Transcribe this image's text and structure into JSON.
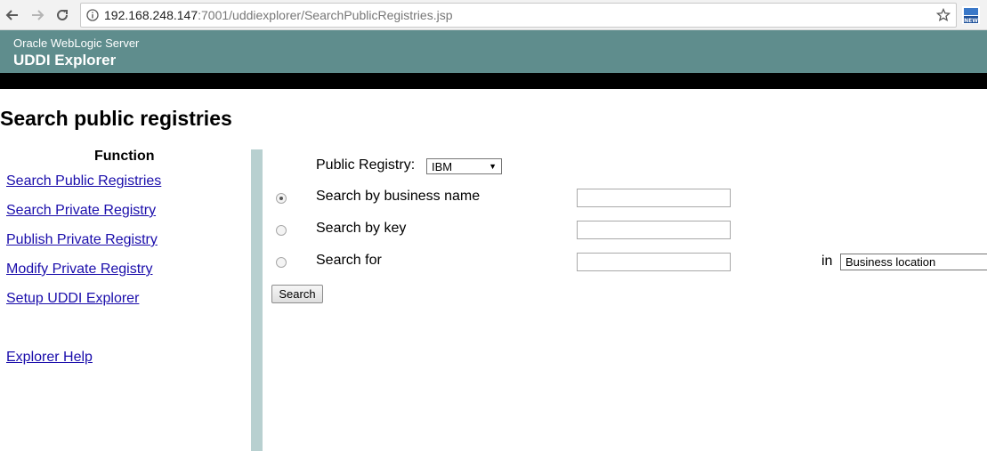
{
  "browser": {
    "url_host": "192.168.248.147",
    "url_rest": ":7001/uddiexplorer/SearchPublicRegistries.jsp",
    "icons": [
      "back-icon",
      "forward-icon",
      "reload-icon",
      "info-icon",
      "star-icon",
      "extension-new-icon"
    ],
    "extension_label": "NEW"
  },
  "header": {
    "subtitle": "Oracle WebLogic Server",
    "title": "UDDI Explorer",
    "background": "#5f8d8d"
  },
  "page": {
    "title": "Search public registries"
  },
  "sidebar": {
    "heading": "Function",
    "links": [
      "Search Public Registries",
      "Search Private Registry",
      "Publish Private Registry",
      "Modify Private Registry",
      "Setup UDDI Explorer"
    ],
    "help": "Explorer Help"
  },
  "form": {
    "registry_label": "Public Registry:",
    "registry_value": "IBM",
    "options": [
      {
        "label": "Search by business name",
        "checked": true,
        "value": ""
      },
      {
        "label": "Search by key",
        "checked": false,
        "value": ""
      },
      {
        "label": "Search for",
        "checked": false,
        "value": ""
      }
    ],
    "in_label": "in",
    "location_value": "Business location",
    "search_button": "Search"
  }
}
